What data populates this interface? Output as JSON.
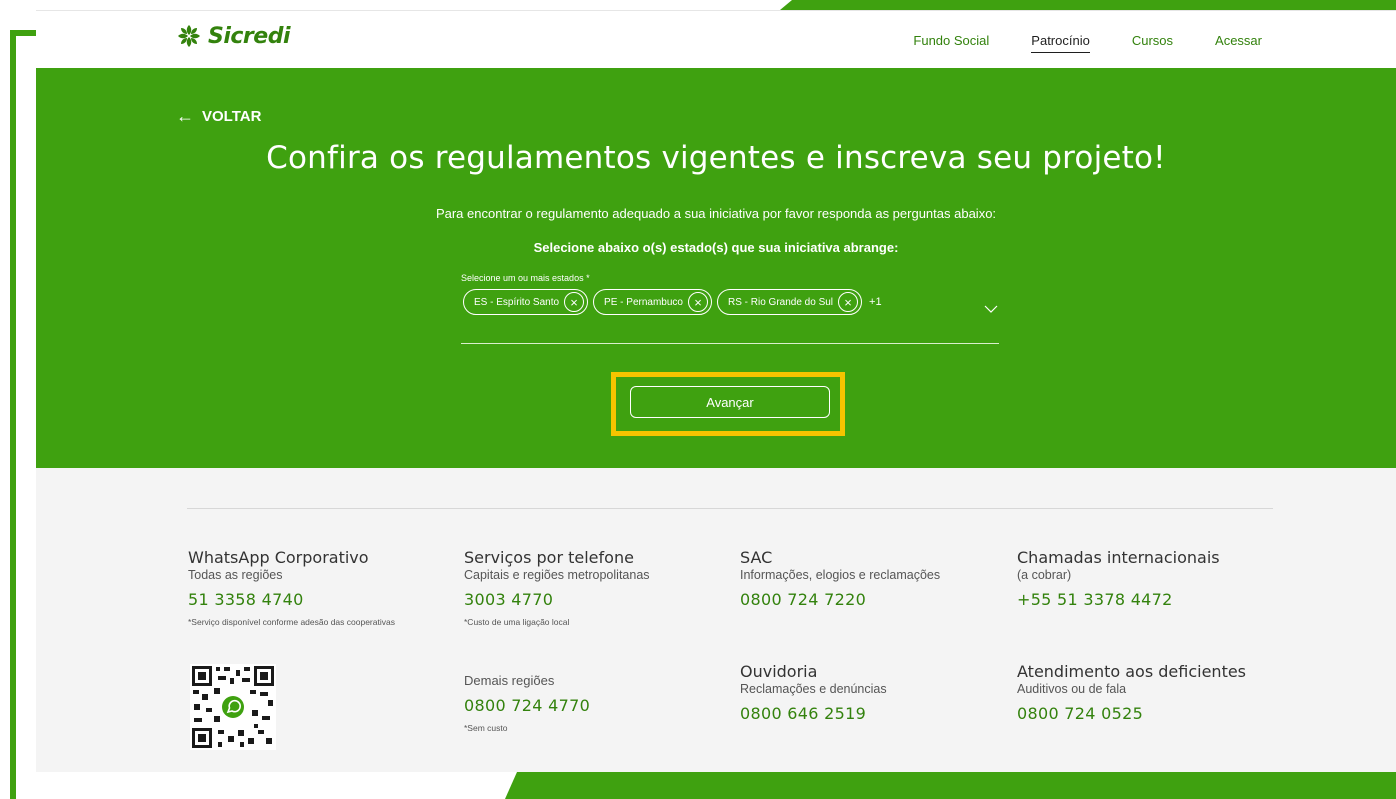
{
  "brand": {
    "name": "Sicredi",
    "color": "#33820d",
    "accent": "#3fa110",
    "highlight": "#f5c400"
  },
  "nav": [
    {
      "label": "Fundo Social",
      "active": false
    },
    {
      "label": "Patrocínio",
      "active": true
    },
    {
      "label": "Cursos",
      "active": false
    },
    {
      "label": "Acessar",
      "active": false
    }
  ],
  "hero": {
    "back_label": "VOLTAR",
    "title": "Confira os regulamentos vigentes e inscreva seu projeto!",
    "subtitle": "Para encontrar o regulamento adequado a sua iniciativa por favor responda as perguntas abaixo:",
    "question": "Selecione abaixo o(s) estado(s) que sua iniciativa abrange:",
    "select": {
      "label": "Selecione um ou mais estados *",
      "chips": [
        "ES - Espírito Santo",
        "PE - Pernambuco",
        "RS - Rio Grande do Sul"
      ],
      "more": "+1"
    },
    "button_label": "Avançar"
  },
  "footer": {
    "whatsapp": {
      "title": "WhatsApp Corporativo",
      "sub": "Todas as regiões",
      "phone": "51 3358 4740",
      "note": "*Serviço disponível conforme adesão das cooperativas"
    },
    "telefone": {
      "title": "Serviços por telefone",
      "sub": "Capitais e regiões metropolitanas",
      "phone": "3003 4770",
      "note": "*Custo de uma ligação local"
    },
    "demais": {
      "sub": "Demais regiões",
      "phone": "0800 724 4770",
      "note": "*Sem custo"
    },
    "sac": {
      "title": "SAC",
      "sub": "Informações, elogios e reclamações",
      "phone": "0800 724 7220"
    },
    "ouvidoria": {
      "title": "Ouvidoria",
      "sub": "Reclamações e denúncias",
      "phone": "0800 646 2519"
    },
    "internacionais": {
      "title": "Chamadas internacionais",
      "sub": "(a cobrar)",
      "phone": "+55 51 3378 4472"
    },
    "deficientes": {
      "title": "Atendimento aos deficientes",
      "sub": "Auditivos ou de fala",
      "phone": "0800 724 0525"
    }
  },
  "icons": [
    "sicredi-logo-icon",
    "arrow-left-icon",
    "close-circle-icon",
    "chevron-down-icon",
    "qr-code-icon",
    "whatsapp-icon"
  ]
}
